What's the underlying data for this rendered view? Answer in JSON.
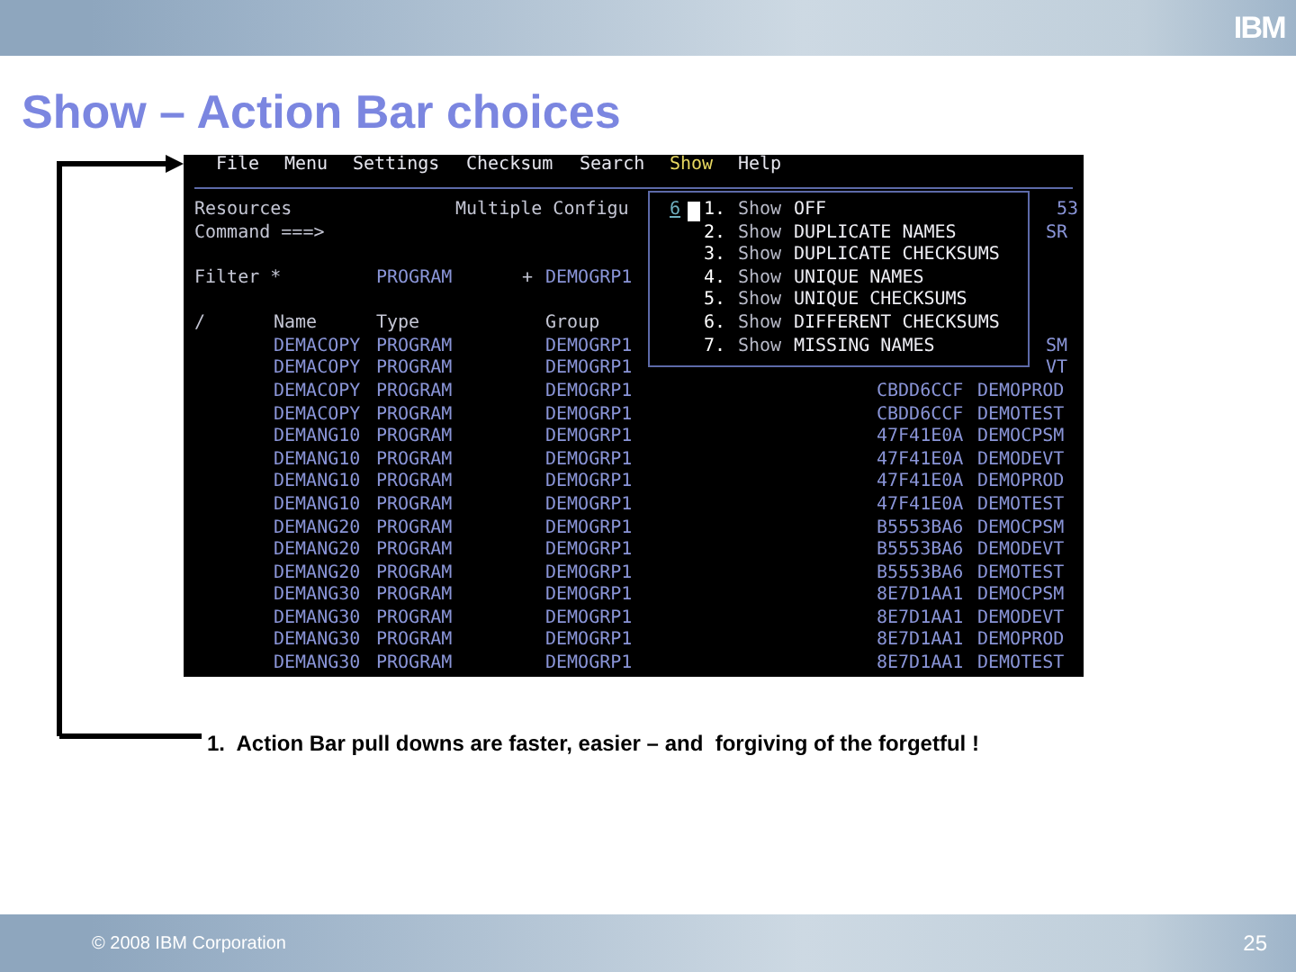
{
  "header": {
    "logo": "IBM"
  },
  "title": "Show – Action Bar choices",
  "terminal": {
    "menu_bar": [
      {
        "label": "File",
        "selected": false
      },
      {
        "label": "Menu",
        "selected": false
      },
      {
        "label": "Settings",
        "selected": false
      },
      {
        "label": "Checksum",
        "selected": false
      },
      {
        "label": "Search",
        "selected": false
      },
      {
        "label": "Show",
        "selected": true
      },
      {
        "label": "Help",
        "selected": false
      }
    ],
    "resources_label": "Resources",
    "panel_title": "Multiple Configu",
    "resources_edge": "53",
    "command_label": "Command ===>",
    "command_edge": "SR",
    "filter": {
      "label": "Filter *",
      "type": "PROGRAM",
      "marker": "+",
      "group": "DEMOGRP1"
    },
    "columns": [
      "/",
      "Name",
      "Type",
      "Group"
    ],
    "rows": [
      {
        "name": "DEMACOPY",
        "type": "PROGRAM",
        "group": "DEMOGRP1",
        "edge": "SM"
      },
      {
        "name": "DEMACOPY",
        "type": "PROGRAM",
        "group": "DEMOGRP1",
        "edge": "VT"
      },
      {
        "name": "DEMACOPY",
        "type": "PROGRAM",
        "group": "DEMOGRP1",
        "checksum": "CBDD6CCF",
        "environment": "DEMOPROD"
      },
      {
        "name": "DEMACOPY",
        "type": "PROGRAM",
        "group": "DEMOGRP1",
        "checksum": "CBDD6CCF",
        "environment": "DEMOTEST"
      },
      {
        "name": "DEMANG10",
        "type": "PROGRAM",
        "group": "DEMOGRP1",
        "checksum": "47F41E0A",
        "environment": "DEMOCPSM"
      },
      {
        "name": "DEMANG10",
        "type": "PROGRAM",
        "group": "DEMOGRP1",
        "checksum": "47F41E0A",
        "environment": "DEMODEVT"
      },
      {
        "name": "DEMANG10",
        "type": "PROGRAM",
        "group": "DEMOGRP1",
        "checksum": "47F41E0A",
        "environment": "DEMOPROD"
      },
      {
        "name": "DEMANG10",
        "type": "PROGRAM",
        "group": "DEMOGRP1",
        "checksum": "47F41E0A",
        "environment": "DEMOTEST"
      },
      {
        "name": "DEMANG20",
        "type": "PROGRAM",
        "group": "DEMOGRP1",
        "checksum": "B5553BA6",
        "environment": "DEMOCPSM"
      },
      {
        "name": "DEMANG20",
        "type": "PROGRAM",
        "group": "DEMOGRP1",
        "checksum": "B5553BA6",
        "environment": "DEMODEVT"
      },
      {
        "name": "DEMANG20",
        "type": "PROGRAM",
        "group": "DEMOGRP1",
        "checksum": "B5553BA6",
        "environment": "DEMOTEST"
      },
      {
        "name": "DEMANG30",
        "type": "PROGRAM",
        "group": "DEMOGRP1",
        "checksum": "8E7D1AA1",
        "environment": "DEMOCPSM"
      },
      {
        "name": "DEMANG30",
        "type": "PROGRAM",
        "group": "DEMOGRP1",
        "checksum": "8E7D1AA1",
        "environment": "DEMODEVT"
      },
      {
        "name": "DEMANG30",
        "type": "PROGRAM",
        "group": "DEMOGRP1",
        "checksum": "8E7D1AA1",
        "environment": "DEMOPROD"
      },
      {
        "name": "DEMANG30",
        "type": "PROGRAM",
        "group": "DEMOGRP1",
        "checksum": "8E7D1AA1",
        "environment": "DEMOTEST"
      }
    ],
    "popup": {
      "input": "6",
      "items": [
        {
          "number": "1.",
          "verb": "Show",
          "option": "OFF",
          "cursor": true
        },
        {
          "number": "2.",
          "verb": "Show",
          "option": "DUPLICATE NAMES",
          "cursor": false
        },
        {
          "number": "3.",
          "verb": "Show",
          "option": "DUPLICATE CHECKSUMS",
          "cursor": false
        },
        {
          "number": "4.",
          "verb": "Show",
          "option": "UNIQUE NAMES",
          "cursor": false
        },
        {
          "number": "5.",
          "verb": "Show",
          "option": "UNIQUE CHECKSUMS",
          "cursor": false
        },
        {
          "number": "6.",
          "verb": "Show",
          "option": "DIFFERENT CHECKSUMS",
          "cursor": false
        },
        {
          "number": "7.",
          "verb": "Show",
          "option": "MISSING NAMES",
          "cursor": false
        }
      ]
    }
  },
  "caption": "1.  Action Bar pull downs are faster, easier – and  forgiving of the forgetful !",
  "footer": {
    "copyright": "© 2008 IBM Corporation",
    "page": "25"
  }
}
